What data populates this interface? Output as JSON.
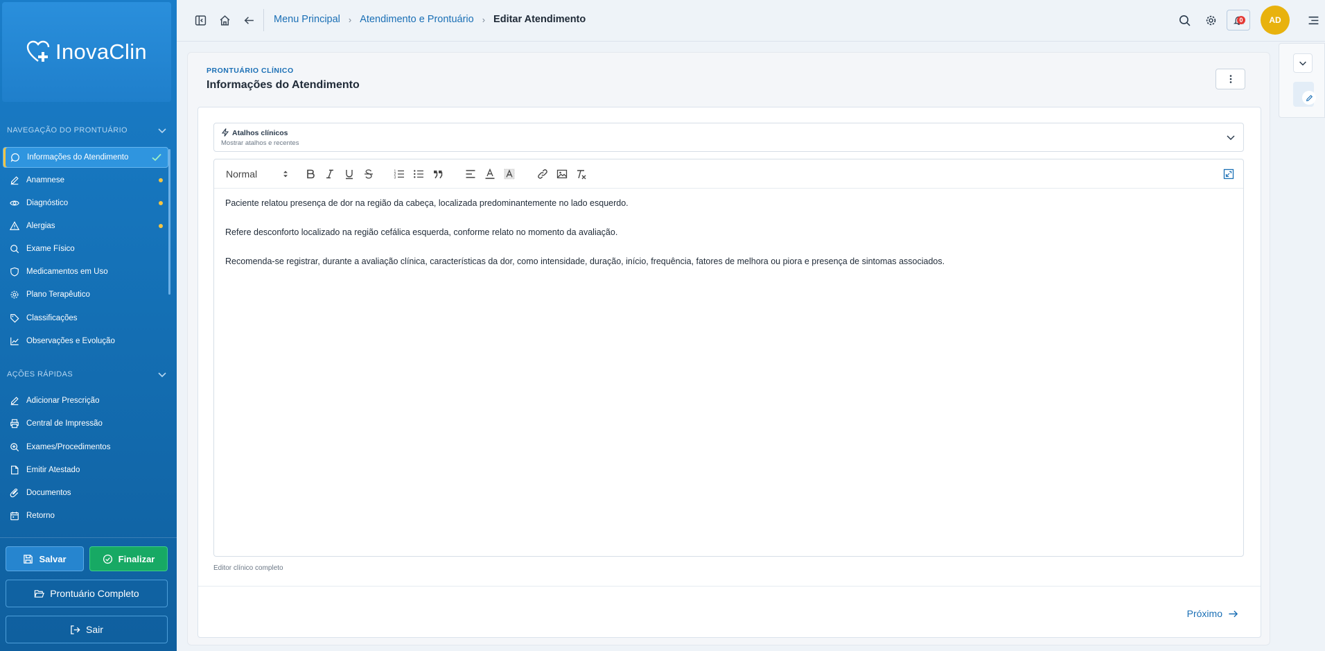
{
  "brand": {
    "name": "InovaClin"
  },
  "sidebar": {
    "nav_section_title": "NAVEGAÇÃO DO PRONTUÁRIO",
    "nav_items": [
      {
        "label": "Informações do Atendimento",
        "icon": "message-circle-icon",
        "status": "done"
      },
      {
        "label": "Anamnese",
        "icon": "edit-icon",
        "status": "pending"
      },
      {
        "label": "Diagnóstico",
        "icon": "eye-icon",
        "status": "pending"
      },
      {
        "label": "Alergias",
        "icon": "alert-triangle-icon",
        "status": "pending"
      },
      {
        "label": "Exame Físico",
        "icon": "search-icon",
        "status": "none"
      },
      {
        "label": "Medicamentos em Uso",
        "icon": "shield-icon",
        "status": "none"
      },
      {
        "label": "Plano Terapêutico",
        "icon": "gear-icon",
        "status": "none"
      },
      {
        "label": "Classificações",
        "icon": "tag-icon",
        "status": "none"
      },
      {
        "label": "Observações e Evolução",
        "icon": "chart-line-icon",
        "status": "none"
      }
    ],
    "quick_section_title": "AÇÕES RÁPIDAS",
    "quick_items": [
      {
        "label": "Adicionar Prescrição",
        "icon": "edit-icon"
      },
      {
        "label": "Central de Impressão",
        "icon": "printer-icon"
      },
      {
        "label": "Exames/Procedimentos",
        "icon": "zoom-in-icon"
      },
      {
        "label": "Emitir Atestado",
        "icon": "file-icon"
      },
      {
        "label": "Documentos",
        "icon": "paperclip-icon"
      },
      {
        "label": "Retorno",
        "icon": "calendar-icon"
      }
    ],
    "save_label": "Salvar",
    "finish_label": "Finalizar",
    "full_record_label": "Prontuário Completo",
    "logout_label": "Sair"
  },
  "topbar": {
    "breadcrumb": [
      "Menu Principal",
      "Atendimento e Prontuário",
      "Editar Atendimento"
    ],
    "notification_count": "0",
    "avatar_initials": "AD"
  },
  "main": {
    "eyebrow": "PRONTUÁRIO CLÍNICO",
    "title": "Informações do Atendimento",
    "shortcuts": {
      "title": "Atalhos clínicos",
      "subtitle": "Mostrar atalhos e recentes"
    },
    "editor": {
      "format_value": "Normal",
      "paragraphs": [
        "Paciente relatou presença de dor na região da cabeça, localizada predominantemente no lado esquerdo.",
        "Refere desconforto localizado na região cefálica esquerda, conforme relato no momento da avaliação.",
        "Recomenda-se registrar, durante a avaliação clínica, características da dor, como intensidade, duração, início, frequência, fatores de melhora ou piora e presença de sintomas associados."
      ],
      "caption": "Editor clínico completo"
    },
    "next_label": "Próximo"
  },
  "colors": {
    "sidebar": "#1572b8",
    "accent": "#1a6fb5",
    "success": "#17a964",
    "pending_dot": "#f5c542",
    "avatar": "#e8b20e",
    "badge": "#e53935"
  }
}
